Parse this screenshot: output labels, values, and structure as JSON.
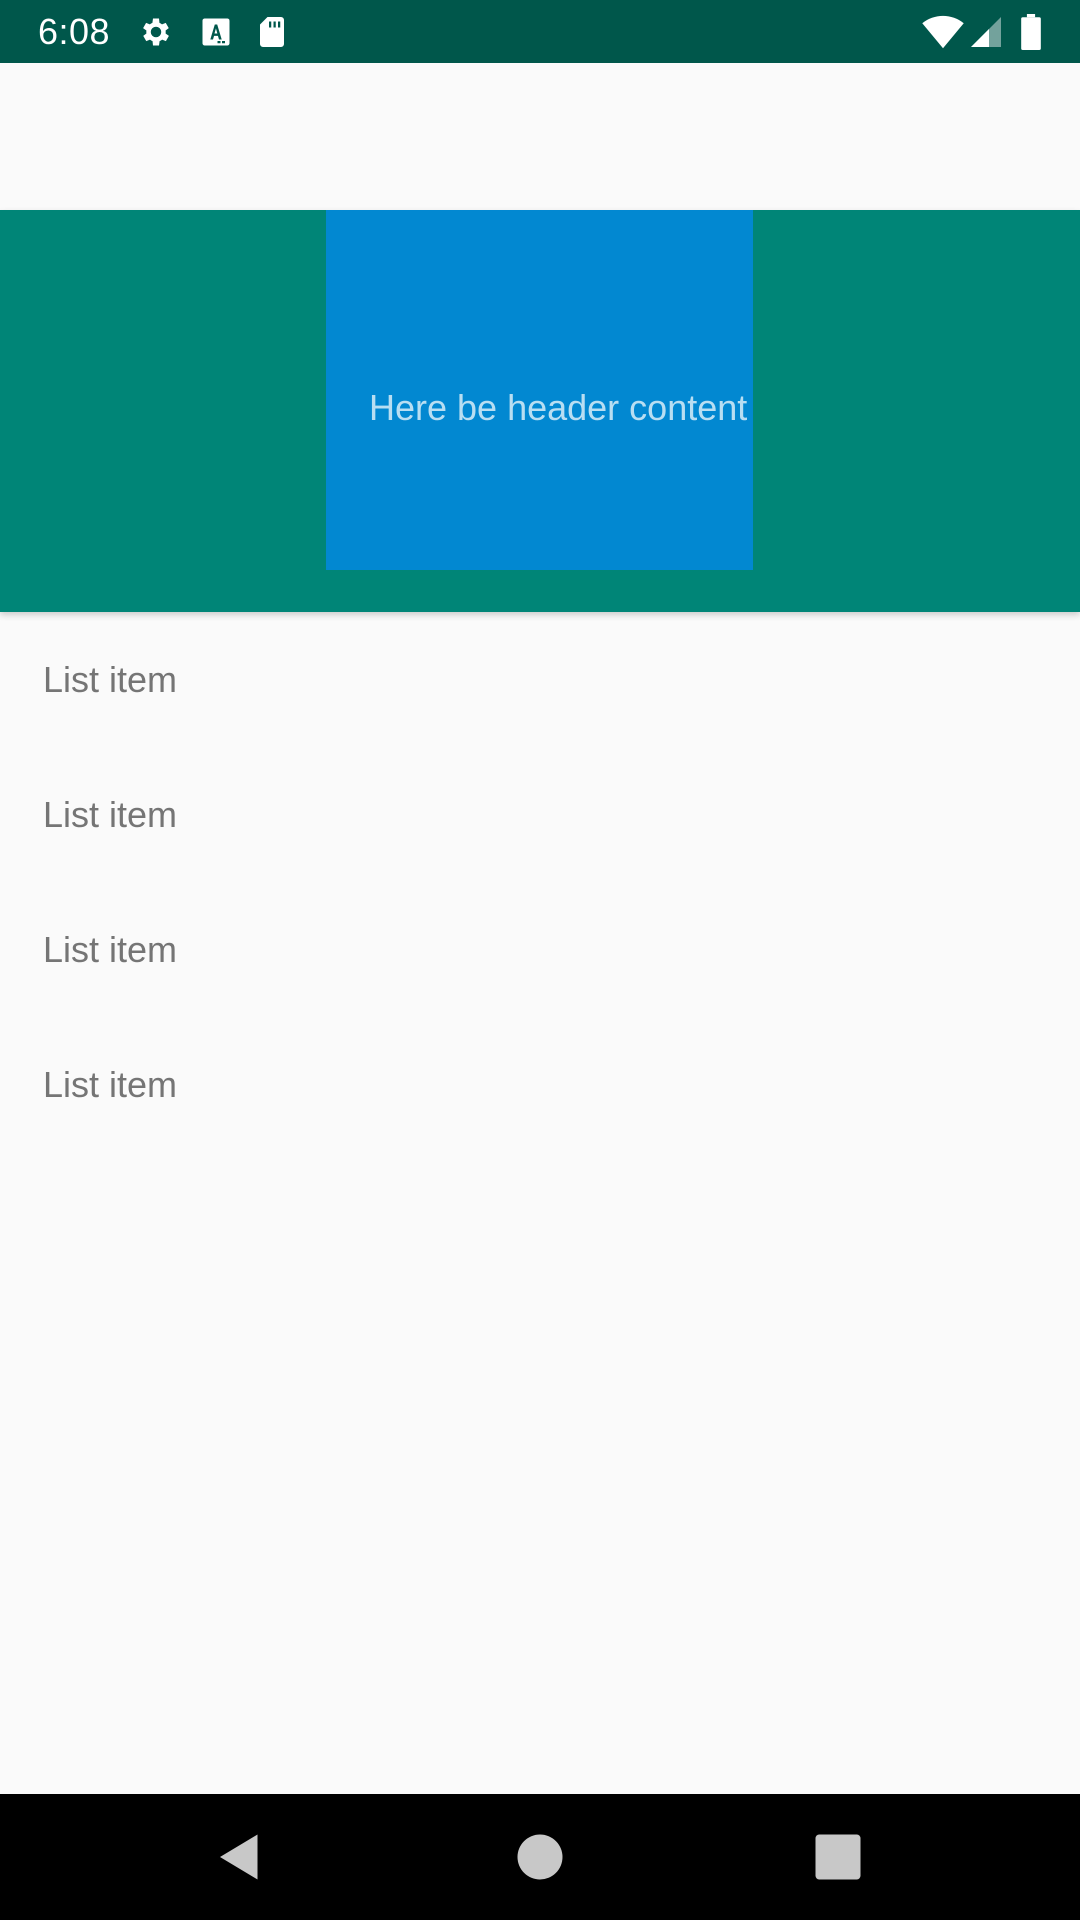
{
  "status_bar": {
    "time": "6:08",
    "background": "#00574b",
    "icons_left": [
      "gear-icon",
      "font-a-icon",
      "sd-card-icon"
    ],
    "icons_right": [
      "wifi-icon",
      "cell-signal-icon",
      "battery-icon"
    ]
  },
  "header": {
    "background": "#008577",
    "inner_box_color": "#0288d1",
    "content_text": "Here be header content"
  },
  "list": {
    "items": [
      {
        "label": "List item"
      },
      {
        "label": "List item"
      },
      {
        "label": "List item"
      },
      {
        "label": "List item"
      }
    ]
  },
  "nav_bar": {
    "buttons": [
      "back-icon",
      "home-icon",
      "recents-icon"
    ]
  }
}
